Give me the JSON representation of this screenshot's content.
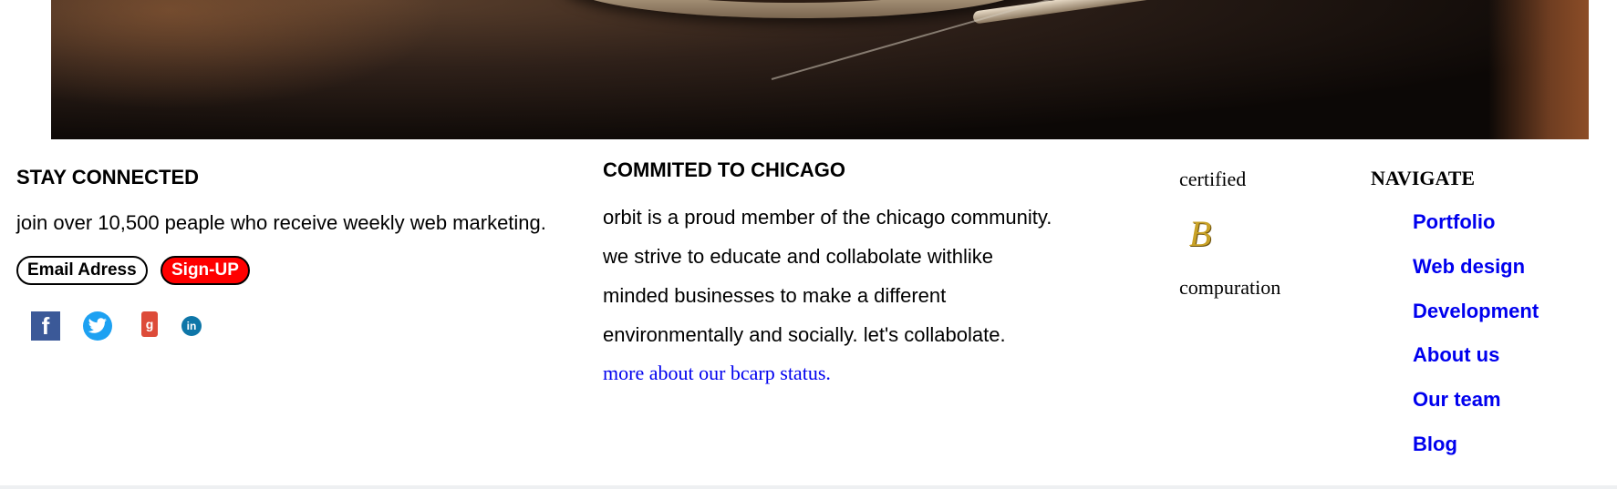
{
  "stay_connected": {
    "heading": "STAY CONNECTED",
    "description": "join over 10,500 peaple who receive weekly web marketing.",
    "email_placeholder": "Email Adress",
    "signup_label": "Sign-UP",
    "social_icons": [
      "facebook-icon",
      "twitter-icon",
      "google-plus-icon",
      "linkedin-icon"
    ],
    "signup_color": "#ff0000"
  },
  "commited": {
    "heading": "COMMITED TO CHICAGO",
    "lines": [
      "orbit is a proud member of the chicago community.",
      "we strive to educate and collabolate withlike",
      "minded businesses to make a different",
      "environmentally and socially. let's collabolate."
    ],
    "link": "more about our bcarp status."
  },
  "certified": {
    "top_text": "certified",
    "badge_letter": "B",
    "bottom_text": "compuration"
  },
  "navigate": {
    "title": "NAVIGATE",
    "links": [
      "Portfolio",
      "Web design",
      "Development",
      "About us",
      "Our team",
      "Blog"
    ],
    "link_color": "#0000ee"
  }
}
